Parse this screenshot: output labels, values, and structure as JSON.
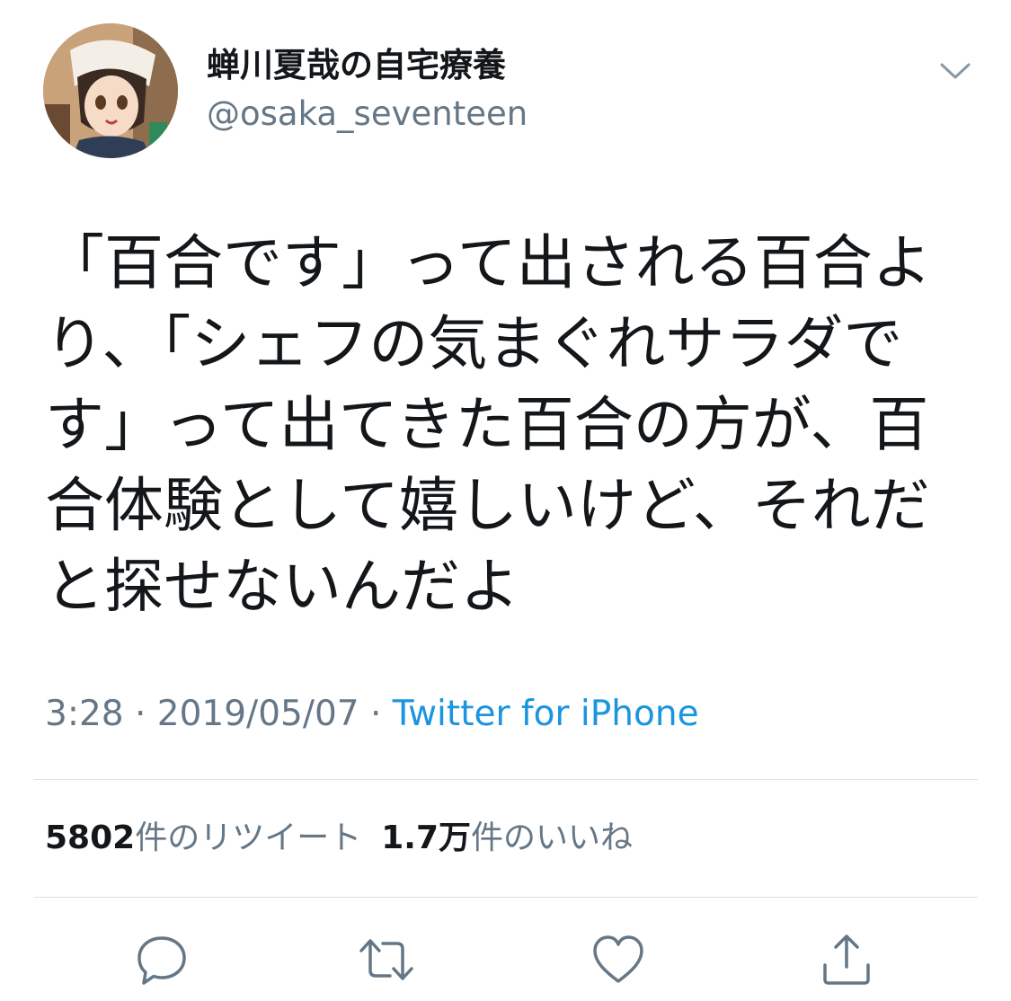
{
  "user": {
    "display_name": "蝉川夏哉の自宅療養",
    "handle": "@osaka_seventeen",
    "avatar_icon": "user-avatar-image"
  },
  "tweet": {
    "text": "「百合です」って出される百合より、「シェフの気まぐれサラダです」って出てきた百合の方が、百合体験として嬉しいけど、それだと探せないんだよ"
  },
  "meta": {
    "time": "3:28",
    "separator": " · ",
    "date": "2019/05/07",
    "source": "Twitter for iPhone"
  },
  "stats": {
    "retweets_count": "5802",
    "retweets_label": "件のリツイート",
    "likes_count": "1.7万",
    "likes_label": "件のいいね"
  },
  "icons": {
    "menu": "chevron-down-icon",
    "reply": "reply-icon",
    "retweet": "retweet-icon",
    "like": "heart-icon",
    "share": "share-icon"
  },
  "colors": {
    "text": "#14171a",
    "secondary": "#657786",
    "link": "#1b95e0",
    "divider": "#dbe1e6"
  }
}
